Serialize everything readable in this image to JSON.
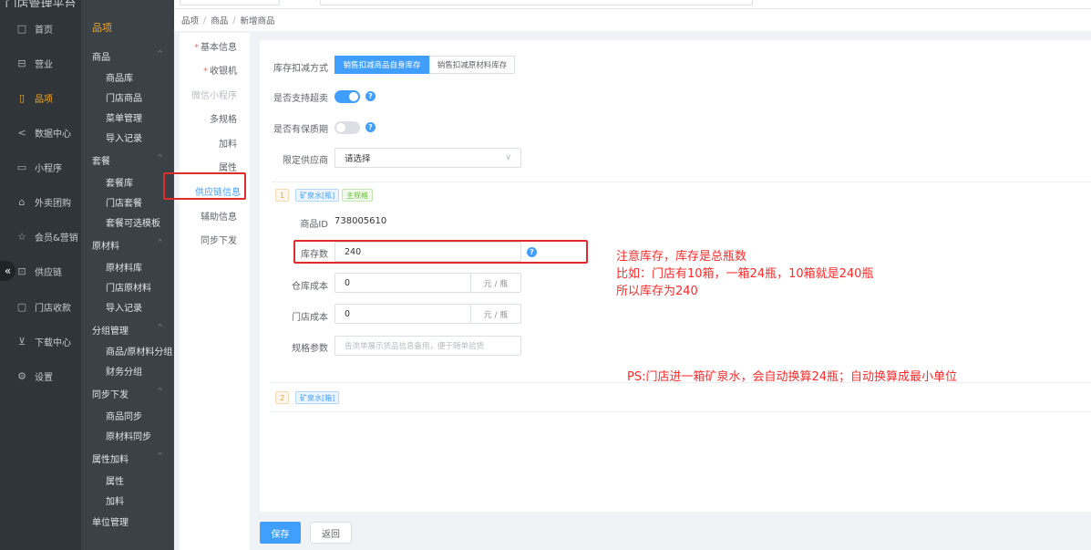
{
  "app": {
    "brand": "门店管理平台"
  },
  "rail": {
    "items": [
      {
        "label": "首页",
        "icon": "home-icon"
      },
      {
        "label": "营业",
        "icon": "shop-icon"
      },
      {
        "label": "品项",
        "icon": "product-icon"
      },
      {
        "label": "数据中心",
        "icon": "share-icon"
      },
      {
        "label": "小程序",
        "icon": "phone-icon"
      },
      {
        "label": "外卖团购",
        "icon": "bag-icon"
      },
      {
        "label": "会员&营销",
        "icon": "star-icon"
      },
      {
        "label": "供应链",
        "icon": "truck-icon"
      },
      {
        "label": "门店收款",
        "icon": "book-icon"
      },
      {
        "label": "下载中心",
        "icon": "download-icon"
      },
      {
        "label": "设置",
        "icon": "gear-icon"
      }
    ],
    "collapse_glyph": "«"
  },
  "submenu": {
    "title": "品项",
    "groups": [
      {
        "label": "商品",
        "items": [
          "商品库",
          "门店商品",
          "菜单管理",
          "导入记录"
        ]
      },
      {
        "label": "套餐",
        "items": [
          "套餐库",
          "门店套餐",
          "套餐可选模板"
        ]
      },
      {
        "label": "原材料",
        "items": [
          "原材料库",
          "门店原材料",
          "导入记录"
        ]
      },
      {
        "label": "分组管理",
        "items": [
          "商品/原材料分组",
          "财务分组"
        ]
      },
      {
        "label": "同步下发",
        "items": [
          "商品同步",
          "原材料同步"
        ]
      },
      {
        "label": "属性加料",
        "items": [
          "属性",
          "加料"
        ]
      },
      {
        "label": "单位管理",
        "items": []
      }
    ]
  },
  "breadcrumb": [
    "品项",
    "商品",
    "新增商品"
  ],
  "steps": [
    {
      "label": "基本信息",
      "required": true,
      "state": "normal"
    },
    {
      "label": "收银机",
      "required": true,
      "state": "normal"
    },
    {
      "label": "微信小程序",
      "required": false,
      "state": "disabled"
    },
    {
      "label": "多规格",
      "required": false,
      "state": "normal"
    },
    {
      "label": "加料",
      "required": false,
      "state": "normal"
    },
    {
      "label": "属性",
      "required": false,
      "state": "normal"
    },
    {
      "label": "供应链信息",
      "required": false,
      "state": "active"
    },
    {
      "label": "辅助信息",
      "required": false,
      "state": "normal"
    },
    {
      "label": "同步下发",
      "required": false,
      "state": "normal"
    }
  ],
  "form": {
    "deduct_label": "库存扣减方式",
    "deduct_options": [
      "销售扣减商品自身库存",
      "销售扣减原材料库存"
    ],
    "oversell_label": "是否支持超卖",
    "oversell_on": true,
    "shelf_label": "是否有保质期",
    "shelf_on": false,
    "supplier_label": "限定供应商",
    "supplier_placeholder": "请选择",
    "spec1": {
      "index": "1",
      "name": "矿泉水[瓶]",
      "tag": "主规格",
      "id_label": "商品ID",
      "id_value": "738005610",
      "stock_label": "库存数",
      "stock_value": "240",
      "warehouse_cost_label": "仓库成本",
      "warehouse_cost_value": "0",
      "store_cost_label": "门店成本",
      "store_cost_value": "0",
      "unit": "元 / 瓶",
      "params_label": "规格参数",
      "params_placeholder": "告流单展示货品信息备用，便于随单验货"
    },
    "spec2": {
      "index": "2",
      "name": "矿泉水[箱]"
    }
  },
  "annotations": {
    "line1": "注意库存，库存是总瓶数",
    "line2": "比如：门店有10箱，一箱24瓶，10箱就是240瓶",
    "line3": "所以库存为240",
    "ps": "PS:门店进一箱矿泉水，会自动换算24瓶；自动换算成最小单位"
  },
  "footer": {
    "save": "保存",
    "back": "返回"
  },
  "colors": {
    "primary": "#409eff",
    "accent": "#f5a623",
    "annotation": "#ff2a2a"
  }
}
